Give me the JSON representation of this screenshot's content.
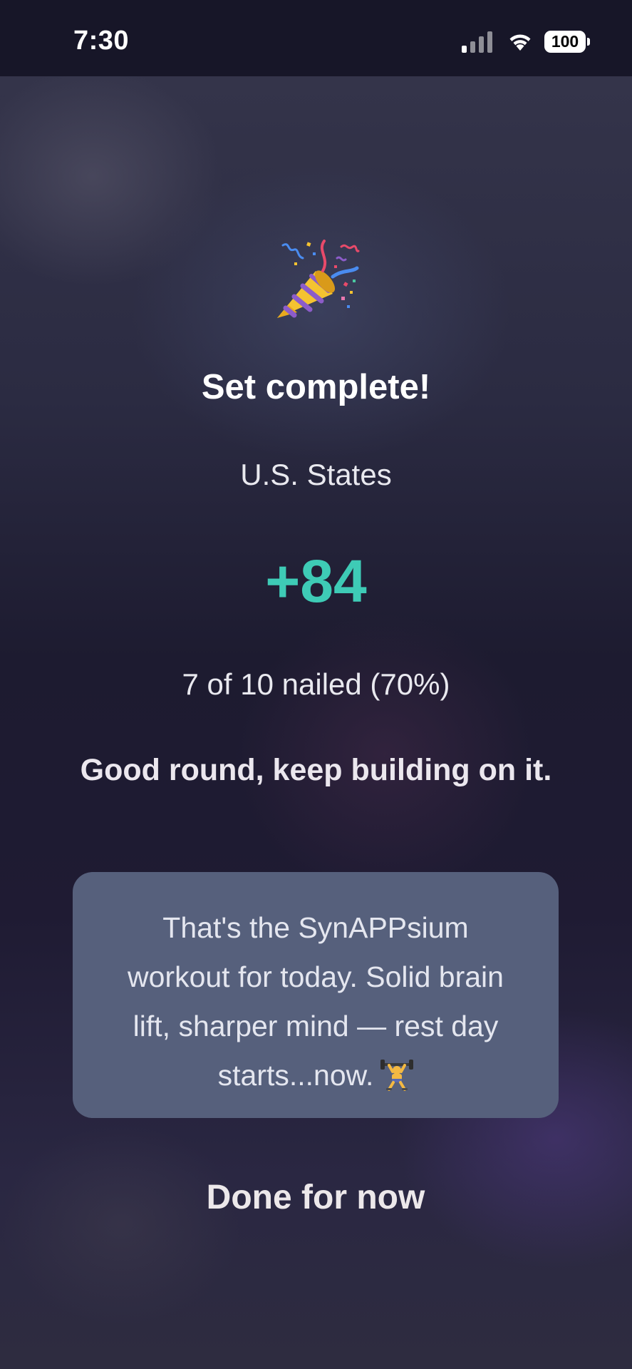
{
  "status_bar": {
    "time": "7:30",
    "battery_level": "100",
    "signal_icon": "cellular-signal-icon",
    "wifi_icon": "wifi-icon",
    "battery_icon": "battery-icon"
  },
  "completion": {
    "icon": "party-popper-icon",
    "title": "Set complete!",
    "category": "U.S. States",
    "score": "+84",
    "accuracy": "7 of 10 nailed (70%)",
    "encouragement": "Good round, keep building on it.",
    "message": "That's the SynAPPsium workout for today. Solid brain lift, sharper mind — rest day starts...now.",
    "message_icon": "weight-lifter-icon"
  },
  "actions": {
    "done_label": "Done for now"
  },
  "colors": {
    "score_accent": "#3ecbb6",
    "card_background": "#56607c",
    "status_bar_background": "#171628"
  }
}
